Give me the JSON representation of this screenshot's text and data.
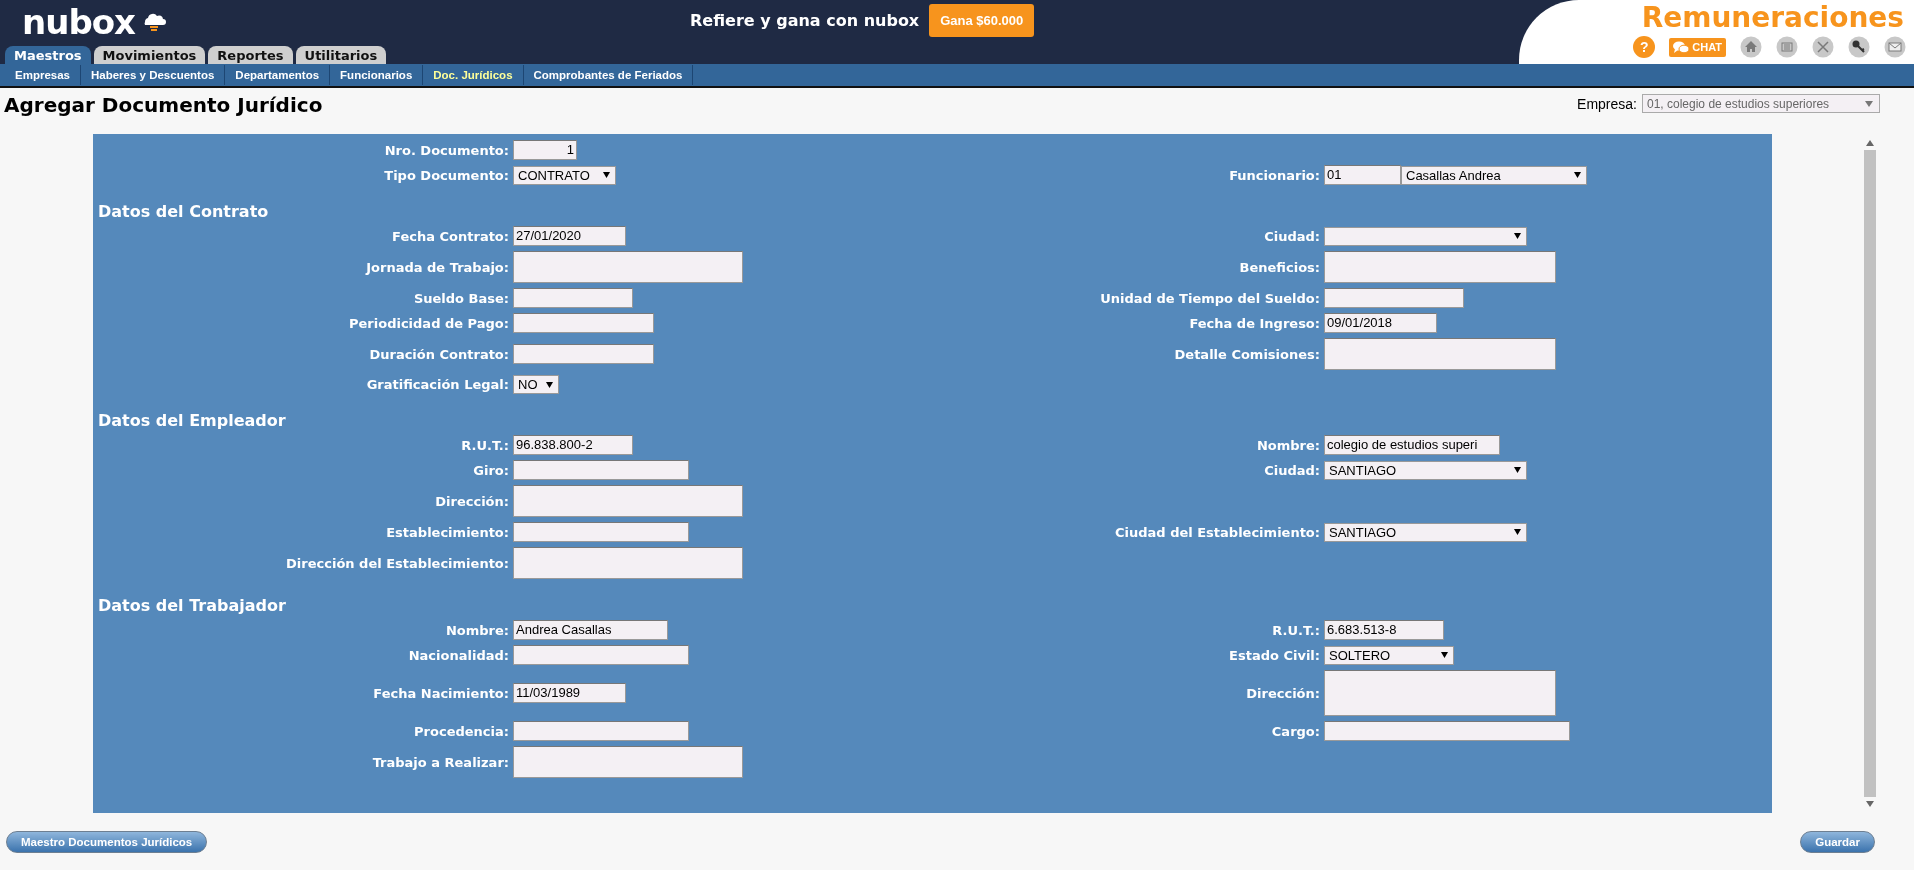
{
  "header": {
    "logo": "nubox",
    "promo_text": "Refiere y gana con nubox",
    "promo_button": "Gana $60.000",
    "product": "Remuneraciones",
    "help_label": "?",
    "chat_button": "CHAT"
  },
  "tabs": [
    {
      "label": "Maestros",
      "selected": true
    },
    {
      "label": "Movimientos",
      "selected": false
    },
    {
      "label": "Reportes",
      "selected": false
    },
    {
      "label": "Utilitarios",
      "selected": false
    }
  ],
  "subnav": [
    {
      "label": "Empresas",
      "selected": false
    },
    {
      "label": "Haberes y Descuentos",
      "selected": false
    },
    {
      "label": "Departamentos",
      "selected": false
    },
    {
      "label": "Funcionarios",
      "selected": false
    },
    {
      "label": "Doc. Jurídicos",
      "selected": true
    },
    {
      "label": "Comprobantes de Feriados",
      "selected": false
    }
  ],
  "page_title": "Agregar Documento Jurídico",
  "empresa": {
    "label": "Empresa:",
    "value": "01, colegio de estudios superiores"
  },
  "form": {
    "sections": [
      {
        "rows": [
          {
            "left": {
              "label": "Nro. Documento:",
              "kind": "number",
              "value": "1"
            }
          },
          {
            "left": {
              "label": "Tipo Documento:",
              "kind": "select",
              "value": "CONTRATO"
            },
            "right": {
              "label": "Funcionario:",
              "kind": "code-select",
              "value": "01",
              "option": "Casallas Andrea"
            }
          }
        ]
      },
      {
        "title": "Datos del Contrato",
        "rows": [
          {
            "left": {
              "label": "Fecha Contrato:",
              "kind": "input",
              "value": "27/01/2020"
            },
            "right": {
              "label": "Ciudad:",
              "kind": "select"
            }
          },
          {
            "left": {
              "label": "Jornada de Trabajo:",
              "kind": "memo"
            },
            "right": {
              "label": "Beneficios:",
              "kind": "memo"
            }
          },
          {
            "left": {
              "label": "Sueldo Base:",
              "kind": "input"
            },
            "right": {
              "label": "Unidad de Tiempo del Sueldo:",
              "kind": "input"
            }
          },
          {
            "left": {
              "label": "Periodicidad de Pago:",
              "kind": "input"
            },
            "right": {
              "label": "Fecha de Ingreso:",
              "kind": "input",
              "value": "09/01/2018"
            }
          },
          {
            "left": {
              "label": "Duración Contrato:",
              "kind": "input"
            },
            "right": {
              "label": "Detalle Comisiones:",
              "kind": "memo"
            }
          },
          {
            "left": {
              "label": "Gratificación Legal:",
              "kind": "select",
              "value": "NO"
            }
          }
        ]
      },
      {
        "title": "Datos del Empleador",
        "rows": [
          {
            "left": {
              "label": "R.U.T.:",
              "kind": "input",
              "value": "96.838.800-2"
            },
            "right": {
              "label": "Nombre:",
              "kind": "input",
              "value": "colegio de estudios superi"
            }
          },
          {
            "left": {
              "label": "Giro:",
              "kind": "input"
            },
            "right": {
              "label": "Ciudad:",
              "kind": "select",
              "value": "SANTIAGO"
            }
          },
          {
            "left": {
              "label": "Dirección:",
              "kind": "memo"
            }
          },
          {
            "left": {
              "label": "Establecimiento:",
              "kind": "input"
            },
            "right": {
              "label": "Ciudad del Establecimiento:",
              "kind": "select",
              "value": "SANTIAGO"
            }
          },
          {
            "left": {
              "label": "Dirección del Establecimiento:",
              "kind": "memo"
            }
          }
        ]
      },
      {
        "title": "Datos del Trabajador",
        "rows": [
          {
            "left": {
              "label": "Nombre:",
              "kind": "input",
              "value": "Andrea Casallas"
            },
            "right": {
              "label": "R.U.T.:",
              "kind": "input",
              "value": "6.683.513-8"
            }
          },
          {
            "left": {
              "label": "Nacionalidad:",
              "kind": "input"
            },
            "right": {
              "label": "Estado Civil:",
              "kind": "select",
              "value": "SOLTERO"
            }
          },
          {
            "left": {
              "label": "Fecha Nacimiento:",
              "kind": "input",
              "value": "11/03/1989"
            },
            "right": {
              "label": "Dirección:",
              "kind": "memo"
            }
          },
          {
            "left": {
              "label": "Procedencia:",
              "kind": "input"
            },
            "right": {
              "label": "Cargo:",
              "kind": "input"
            }
          },
          {
            "left": {
              "label": "Trabajo a Realizar:",
              "kind": "memo"
            }
          }
        ]
      }
    ]
  },
  "buttons": {
    "back": "Maestro Documentos Jurídicos",
    "save": "Guardar"
  }
}
